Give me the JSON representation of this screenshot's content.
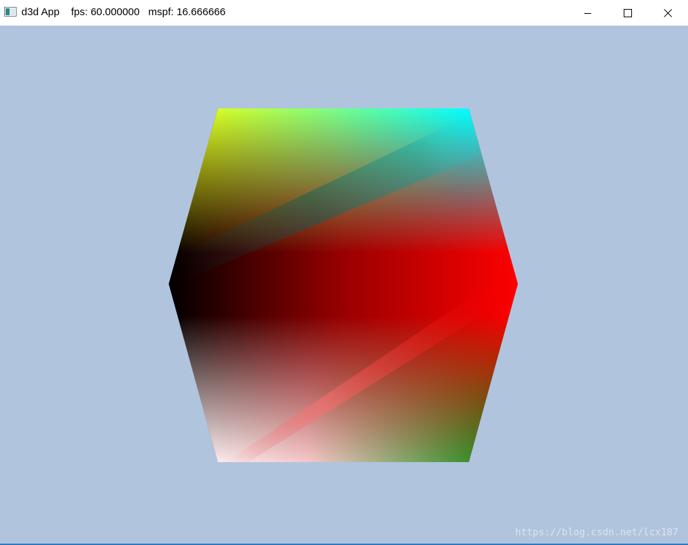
{
  "window": {
    "title": "d3d App    fps: 60.000000   mspf: 16.666666",
    "background_color": "#b0c4de",
    "icons": {
      "app": "application-icon",
      "minimize": "minimize-icon",
      "maximize": "maximize-icon",
      "close": "close-icon"
    }
  },
  "scene": {
    "object": "color-cube",
    "vertex_colors": {
      "top_left": "#ffff00",
      "top_right": "#00ffff",
      "left": "#000000",
      "center": "#b00000",
      "right": "#ff0000",
      "bottom_left": "#ffffff",
      "bottom_right": "#008000"
    }
  },
  "watermark": "https://blog.csdn.net/lcx187"
}
